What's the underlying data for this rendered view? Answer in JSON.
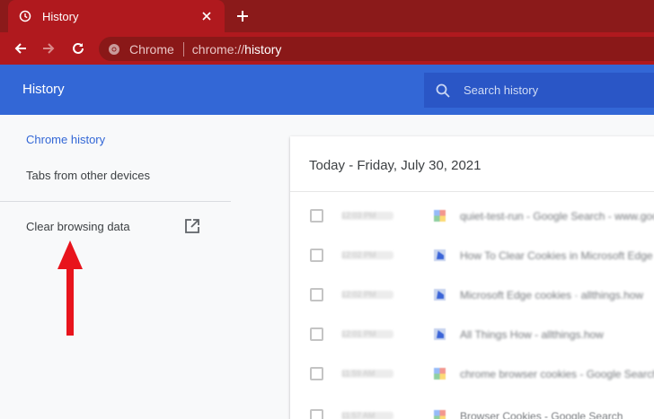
{
  "tab": {
    "title": "History"
  },
  "omnibox": {
    "site": "Chrome",
    "url_scheme": "chrome://",
    "url_path": "history"
  },
  "header": {
    "title": "History",
    "search_placeholder": "Search history"
  },
  "sidebar": {
    "items": [
      {
        "label": "Chrome history"
      },
      {
        "label": "Tabs from other devices"
      },
      {
        "label": "Clear browsing data"
      }
    ]
  },
  "main": {
    "date_heading": "Today - Friday, July 30, 2021",
    "rows": [
      {
        "time": "12:03 PM",
        "title": "quiet-test-run - Google Search - www.google.com",
        "favicon": "google-icon"
      },
      {
        "time": "12:02 PM",
        "title": "How To Clear Cookies in Microsoft Edge",
        "favicon": "bing-icon"
      },
      {
        "time": "12:02 PM",
        "title": "Microsoft Edge cookies · allthings.how",
        "favicon": "bing-icon"
      },
      {
        "time": "12:01 PM",
        "title": "All Things How - allthings.how",
        "favicon": "bing-icon"
      },
      {
        "time": "11:59 AM",
        "title": "chrome browser cookies - Google Search",
        "favicon": "google-icon"
      },
      {
        "time": "11:57 AM",
        "title": "Browser Cookies - Google Search",
        "favicon": "google-icon"
      }
    ]
  },
  "colors": {
    "toolbar": "#b0191e",
    "header": "#3367d6",
    "accent": "#3367d6",
    "arrow": "#e8141c"
  }
}
